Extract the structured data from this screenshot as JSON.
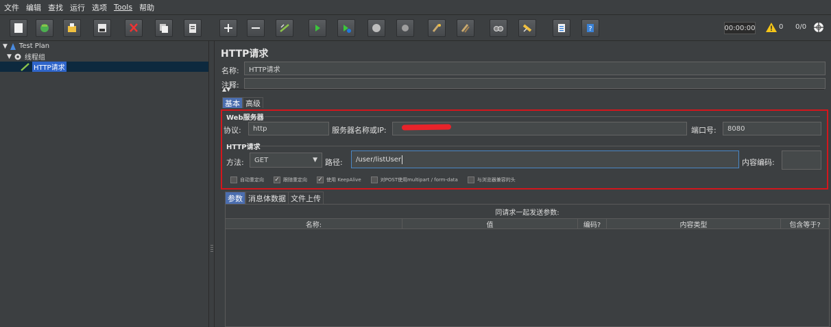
{
  "menu": [
    "文件",
    "编辑",
    "查找",
    "运行",
    "选项",
    "Tools",
    "帮助"
  ],
  "toolbar": {
    "timer": "00:00:00",
    "warn_count": "0",
    "thread_count": "0/0",
    "icons": [
      "new-icon",
      "templates-icon",
      "open-icon",
      "save-icon",
      "cut-icon",
      "copy-icon",
      "paste-icon",
      "expand-icon",
      "collapse-icon",
      "toggle-icon",
      "start-icon",
      "start-no-pause-icon",
      "stop-icon",
      "shutdown-icon",
      "clear-icon",
      "clear-all-icon",
      "search-icon",
      "reset-search-icon",
      "function-helper-icon",
      "help-icon"
    ]
  },
  "tree": {
    "root": "Test Plan",
    "thread_group": "线程组",
    "sampler": "HTTP请求"
  },
  "panel": {
    "title": "HTTP请求",
    "name_label": "名称:",
    "name_value": "HTTP请求",
    "comment_label": "注释:",
    "tabs": [
      "基本",
      "高级"
    ],
    "web_server_title": "Web服务器",
    "protocol_label": "协议:",
    "protocol_value": "http",
    "server_label": "服务器名称或IP:",
    "port_label": "端口号:",
    "port_value": "8080",
    "http_request_title": "HTTP请求",
    "method_label": "方法:",
    "method_value": "GET",
    "path_label": "路径:",
    "path_value": "/user/listUser",
    "encoding_label": "内容编码:",
    "checkboxes": [
      {
        "label": "自动重定向",
        "checked": false
      },
      {
        "label": "跟随重定向",
        "checked": true
      },
      {
        "label": "使用 KeepAlive",
        "checked": true
      },
      {
        "label": "对POST使用multipart / form-data",
        "checked": false
      },
      {
        "label": "与浏览器兼容的头",
        "checked": false
      }
    ],
    "sub_tabs": [
      "参数",
      "消息体数据",
      "文件上传"
    ],
    "table_caption": "同请求一起发送参数:",
    "table_headers": [
      "名称:",
      "值",
      "编码?",
      "内容类型",
      "包含等于?"
    ]
  },
  "colors": {
    "highlight_box": "#d4161c",
    "selection": "#2f65ca",
    "active_tab": "#4b6eaf"
  }
}
